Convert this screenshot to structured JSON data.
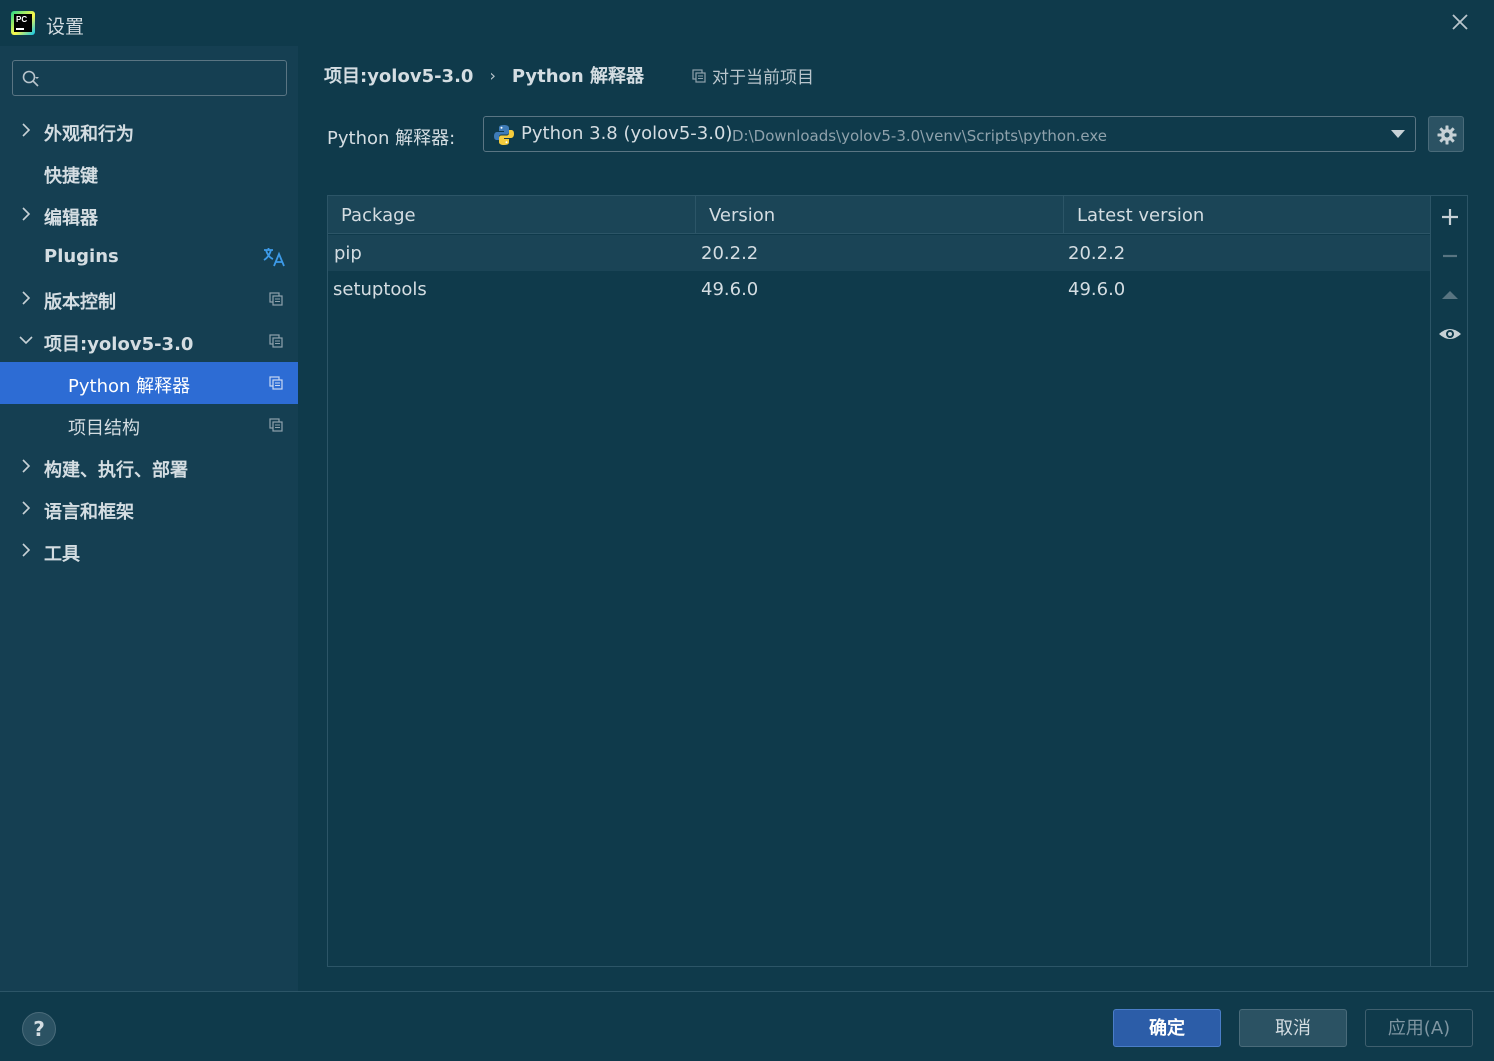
{
  "window": {
    "title": "设置"
  },
  "search": {
    "placeholder": ""
  },
  "sidebar": {
    "items": [
      {
        "label": "外观和行为"
      },
      {
        "label": "快捷键"
      },
      {
        "label": "编辑器"
      },
      {
        "label": "Plugins"
      },
      {
        "label": "版本控制"
      },
      {
        "label": "项目:yolov5-3.0"
      },
      {
        "label": "Python 解释器",
        "selected": true
      },
      {
        "label": "项目结构"
      },
      {
        "label": "构建、执行、部署"
      },
      {
        "label": "语言和框架"
      },
      {
        "label": "工具"
      }
    ]
  },
  "breadcrumb": {
    "project": "项目:yolov5-3.0",
    "page": "Python 解释器",
    "sep": "›"
  },
  "scope_hint": "对于当前项目",
  "interpreter": {
    "label": "Python 解释器:",
    "name": "Python 3.8 (yolov5-3.0)",
    "path": "D:\\Downloads\\yolov5-3.0\\venv\\Scripts\\python.exe"
  },
  "packages_table": {
    "columns": [
      "Package",
      "Version",
      "Latest version"
    ],
    "rows": [
      {
        "package": "pip",
        "version": "20.2.2",
        "latest": "20.2.2"
      },
      {
        "package": "setuptools",
        "version": "49.6.0",
        "latest": "49.6.0"
      }
    ]
  },
  "footer": {
    "help": "?",
    "ok": "确定",
    "cancel": "取消",
    "apply": "应用(A)"
  },
  "colors": {
    "background": "#0f3a4b",
    "sidebar": "#153f52",
    "selection": "#2d6cd4",
    "ok_button": "#2c5da8",
    "accent_translate": "#3d9ae8"
  },
  "icons": {
    "app": "pycharm-logo-icon",
    "close": "close-icon",
    "search": "search-icon",
    "expand": "chevron-right-icon",
    "collapse": "chevron-down-icon",
    "project_scope": "project-scope-icon",
    "translate": "translate-icon",
    "python": "python-icon",
    "settings": "gear-icon",
    "add": "plus-icon",
    "remove": "minus-icon",
    "upgrade": "upgrade-arrow-icon",
    "show_early": "eye-icon"
  }
}
